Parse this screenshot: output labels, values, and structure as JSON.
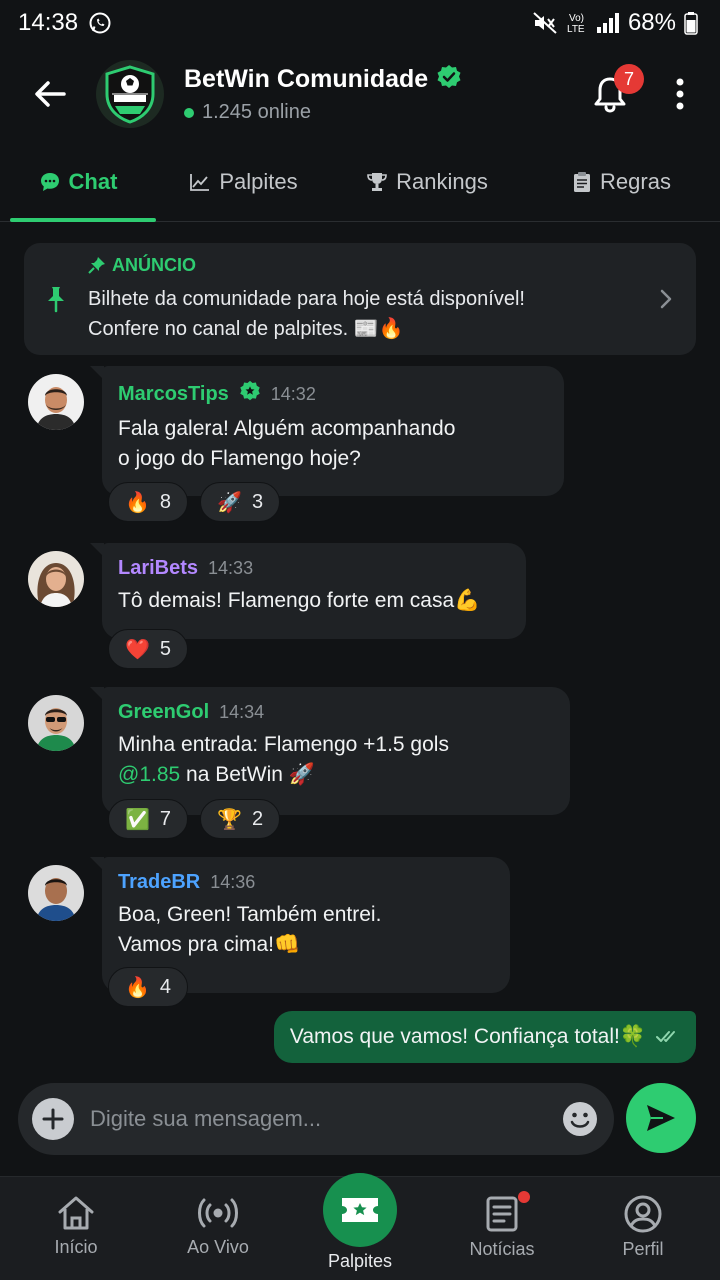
{
  "status_bar": {
    "time": "14:38",
    "battery": "68%"
  },
  "header": {
    "group_name": "BetWin Comunidade",
    "online_text": "1.245 online",
    "notification_count": "7"
  },
  "tabs": [
    {
      "label": "Chat",
      "active": true
    },
    {
      "label": "Palpites",
      "active": false
    },
    {
      "label": "Rankings",
      "active": false
    },
    {
      "label": "Regras",
      "active": false
    }
  ],
  "announcement": {
    "label": "ANÚNCIO",
    "line1": "Bilhete da comunidade para hoje está disponível!",
    "line2": "Confere no canal de palpites. 📰🔥"
  },
  "messages": [
    {
      "author": "MarcosTips",
      "verified": true,
      "time": "14:32",
      "name_color": "#2ecc71",
      "lines": [
        "Fala galera! Alguém acompanhando",
        "o jogo do Flamengo hoje?"
      ],
      "reactions": [
        {
          "emoji": "🔥",
          "count": "8"
        },
        {
          "emoji": "🚀",
          "count": "3"
        }
      ]
    },
    {
      "author": "LariBets",
      "verified": false,
      "time": "14:33",
      "name_color": "#b388ff",
      "lines": [
        "Tô demais! Flamengo forte em casa💪"
      ],
      "reactions": [
        {
          "emoji": "❤️",
          "count": "5"
        }
      ]
    },
    {
      "author": "GreenGol",
      "verified": false,
      "time": "14:34",
      "name_color": "#2ecc71",
      "lines": [
        "Minha entrada: Flamengo +1.5 gols"
      ],
      "odds": "@1.85",
      "odds_suffix": " na BetWin 🚀",
      "reactions": [
        {
          "emoji": "✅",
          "count": "7"
        },
        {
          "emoji": "🏆",
          "count": "2"
        }
      ]
    },
    {
      "author": "TradeBR",
      "verified": false,
      "time": "14:36",
      "name_color": "#4da3ff",
      "lines": [
        "Boa, Green! Também entrei.",
        "Vamos pra cima!👊"
      ],
      "reactions": [
        {
          "emoji": "🔥",
          "count": "4"
        }
      ]
    }
  ],
  "own_message": {
    "text": "Vamos que vamos! Confiança total!🍀"
  },
  "composer": {
    "placeholder": "Digite sua mensagem..."
  },
  "bottom_nav": [
    {
      "label": "Início",
      "icon": "home-icon"
    },
    {
      "label": "Ao Vivo",
      "icon": "live-icon"
    },
    {
      "label": "Palpites",
      "icon": "ticket-icon"
    },
    {
      "label": "Notícias",
      "icon": "news-icon"
    },
    {
      "label": "Perfil",
      "icon": "profile-icon"
    }
  ],
  "colors": {
    "accent": "#2ecc71",
    "background": "#111315",
    "card": "#1f2225",
    "own_bubble": "#13623c",
    "badge": "#e53935"
  }
}
